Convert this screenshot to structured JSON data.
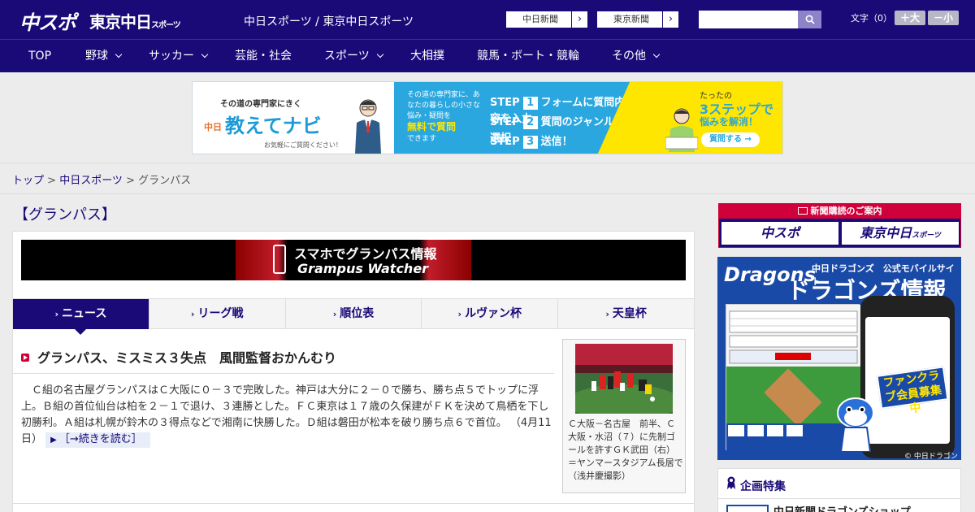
{
  "header": {
    "logo_chuspo": "中スポ",
    "logo_tokyo": "東京中日",
    "logo_tokyo_small": "スポーツ",
    "site_name": "中日スポーツ / 東京中日スポーツ",
    "btn_chunichi": "中日新聞",
    "btn_tokyo": "東京新聞",
    "btn_arrow": "›",
    "search_placeholder": "",
    "search_icon": "search-icon",
    "font_label": "文字（0）",
    "font_bigger": "＋大",
    "font_smaller": "－小"
  },
  "nav": {
    "items": [
      {
        "label": "TOP",
        "has_menu": false
      },
      {
        "label": "野球",
        "has_menu": true
      },
      {
        "label": "サッカー",
        "has_menu": true
      },
      {
        "label": "芸能・社会",
        "has_menu": false
      },
      {
        "label": "スポーツ",
        "has_menu": true
      },
      {
        "label": "大相撲",
        "has_menu": false
      },
      {
        "label": "競馬・ボート・競輪",
        "has_menu": false
      },
      {
        "label": "その他",
        "has_menu": true
      }
    ]
  },
  "banner": {
    "tag": "その道の専門家にきく",
    "title": "教えてナビ",
    "title_prefix": "中日",
    "note": "お気軽にご質問ください！",
    "mid_text": "その道の専門家に、あなたの暮らしの小さな悩み・疑問を",
    "mid_em": "無料で質問",
    "mid_end": "できます",
    "step1": "フォームに質問内容を入力",
    "step2": "質問のジャンルを選択",
    "step3": "送信！",
    "step_label": "STEP",
    "right_t1": "たったの",
    "right_t2": "3ステップで",
    "right_t3": "悩みを解消！",
    "right_btn": "質問する →"
  },
  "breadcrumb": {
    "home": "トップ",
    "sep": " > ",
    "section": "中日スポーツ",
    "current": "グランパス"
  },
  "page_title": "【グランパス】",
  "grampus_banner": {
    "title": "スマホでグランパス情報",
    "subtitle": "Grampus Watcher"
  },
  "tabs": [
    {
      "label": "ニュース",
      "active": true
    },
    {
      "label": "リーグ戦",
      "active": false
    },
    {
      "label": "順位表",
      "active": false
    },
    {
      "label": "ルヴァン杯",
      "active": false
    },
    {
      "label": "天皇杯",
      "active": false
    }
  ],
  "article": {
    "title": "グランパス、ミスミス３失点　風間監督おかんむり",
    "body": "Ｃ組の名古屋グランパスはＣ大阪に０－３で完敗した。神戸は大分に２－０で勝ち、勝ち点５でトップに浮上。Ｂ組の首位仙台は柏を２－１で退け、３連勝とした。ＦＣ東京は１７歳の久保建がＦＫを決めて鳥栖を下し初勝利。Ａ組は札幌が鈴木の３得点などで湘南に快勝した。Ｄ組は磐田が松本を破り勝ち点６で首位。",
    "date": "（4月11日）",
    "read_more": "［→続きを読む］",
    "photo_caption": "Ｃ大阪－名古屋　前半、Ｃ大阪・水沼（７）に先制ゴールを許すＧＫ武田（右）＝ヤンマースタジアム長居で（浅井慶撮影）"
  },
  "sidebar": {
    "subscribe_head": "新聞購読のご案内",
    "subscribe_chuspo": "中スポ",
    "subscribe_tokyo": "東京中日",
    "subscribe_tokyo_small": "スポーツ",
    "dragons_logo": "Dragons",
    "dragons_t1": "中日ドラゴンズ　公式モバイルサイト",
    "dragons_t2": "ドラゴンズ情報",
    "dragons_member": "ファンクラブ会員募集中",
    "dragons_copy": "© 中日ドラゴンズ",
    "feature_head": "企画特集",
    "feature_item": "中日新聞ドラゴンズショップ"
  },
  "colors": {
    "brand_navy": "#1a0a78",
    "accent_red": "#d0003a",
    "banner_blue": "#2aa7df",
    "banner_yellow": "#ffe600"
  }
}
